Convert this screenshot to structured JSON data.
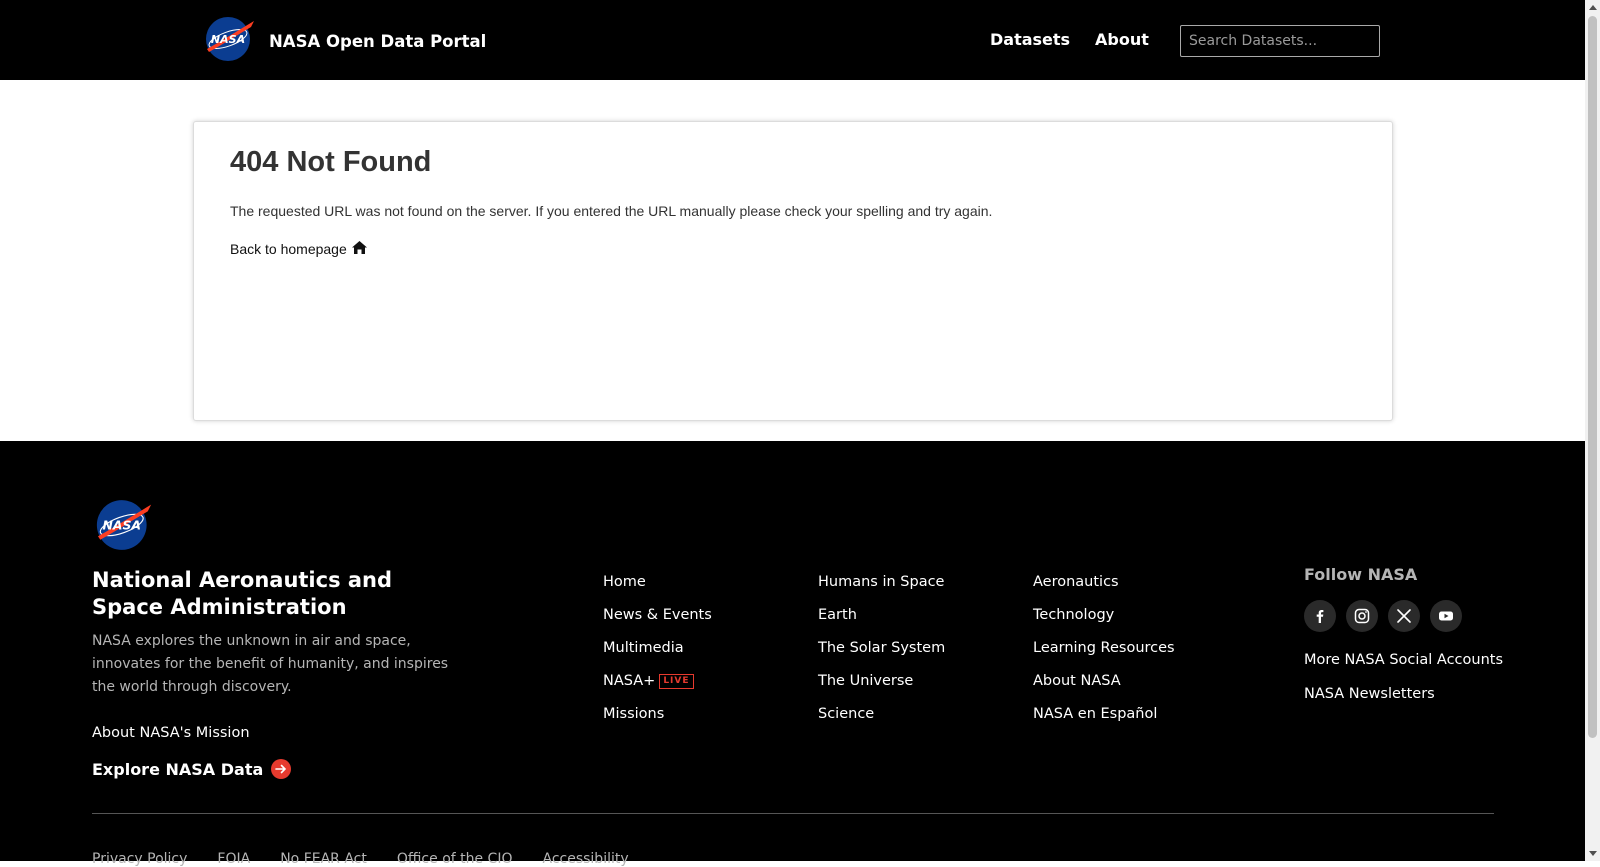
{
  "header": {
    "title": "NASA Open Data Portal",
    "nav": [
      "Datasets",
      "About"
    ],
    "search_placeholder": "Search Datasets..."
  },
  "error": {
    "heading": "404 Not Found",
    "message": "The requested URL was not found on the server. If you entered the URL manually please check your spelling and try again.",
    "back_link": "Back to homepage"
  },
  "footer": {
    "org_name": "National Aeronautics and Space Administration",
    "description": "NASA explores the unknown in air and space, innovates for the benefit of humanity, and inspires the world through discovery.",
    "mission_link": "About NASA's Mission",
    "explore_link": "Explore NASA Data",
    "columns": [
      [
        "Home",
        "News & Events",
        "Multimedia",
        "NASA+",
        "Missions"
      ],
      [
        "Humans in Space",
        "Earth",
        "The Solar System",
        "The Universe",
        "Science"
      ],
      [
        "Aeronautics",
        "Technology",
        "Learning Resources",
        "About NASA",
        "NASA en Español"
      ]
    ],
    "live_badge": "LIVE",
    "follow_title": "Follow NASA",
    "socials": [
      "facebook-icon",
      "instagram-icon",
      "x-icon",
      "youtube-icon"
    ],
    "more_social": "More NASA Social Accounts",
    "newsletters": "NASA Newsletters",
    "legal": [
      "Privacy Policy",
      "FOIA",
      "No FEAR Act",
      "Office of the CIO",
      "Accessibility"
    ]
  },
  "colors": {
    "background": "#000000",
    "accent": "#e63a2e",
    "nasa_blue": "#0b3d91"
  }
}
